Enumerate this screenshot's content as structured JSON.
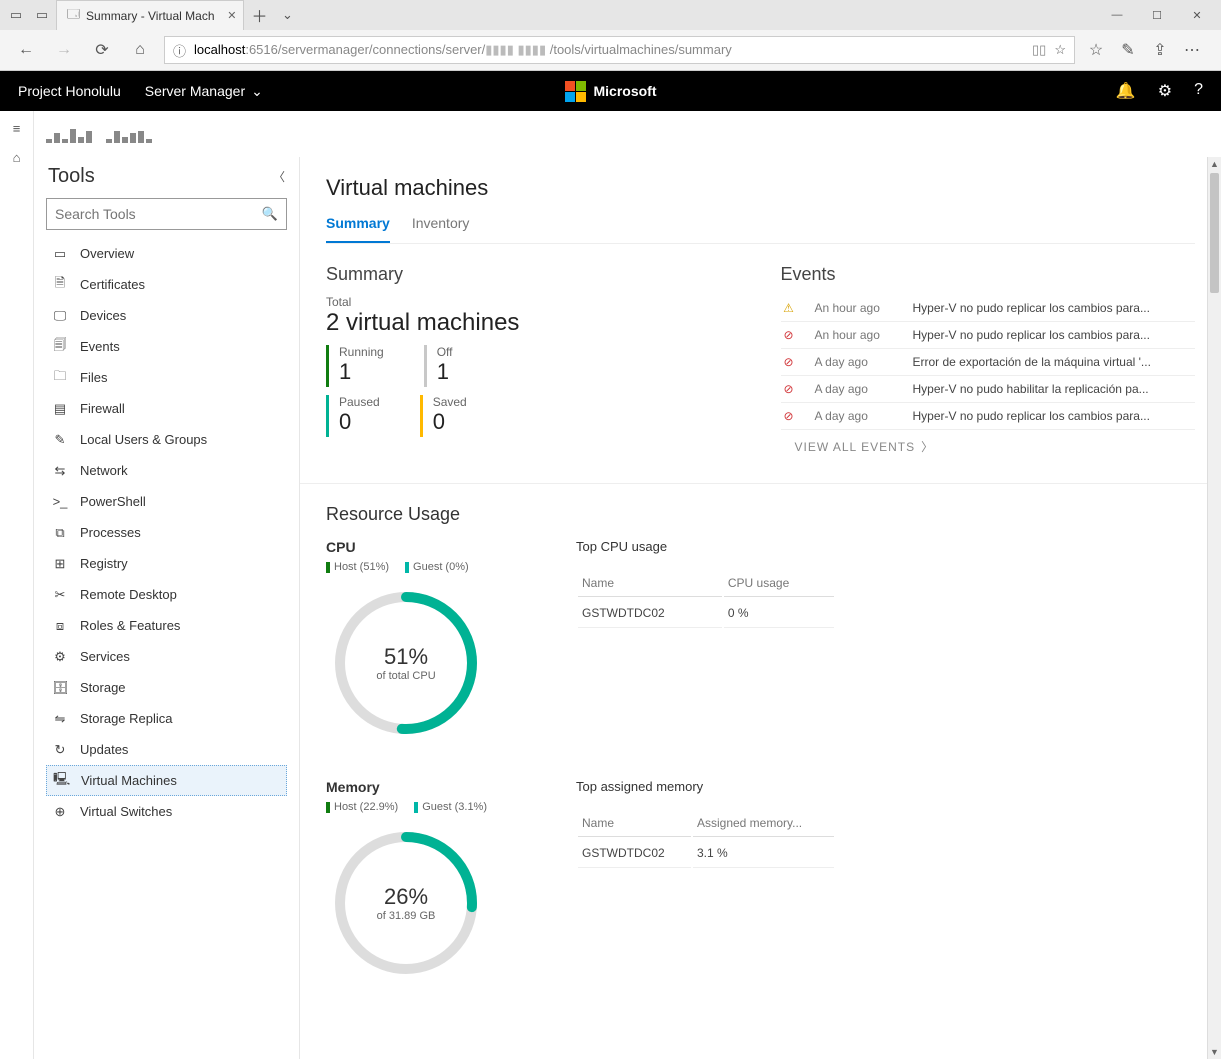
{
  "browser": {
    "tab_title": "Summary - Virtual Mach",
    "addr_host": "localhost",
    "addr_port": ":6516",
    "addr_path_a": "/servermanager/connections/server/",
    "addr_path_b": "/tools/virtualmachines/summary"
  },
  "header": {
    "brand": "Project Honolulu",
    "dropdown": "Server Manager",
    "ms": "Microsoft"
  },
  "tools": {
    "heading": "Tools",
    "search_placeholder": "Search Tools",
    "items": [
      {
        "icon": "▭",
        "label": "Overview"
      },
      {
        "icon": "🗎",
        "label": "Certificates"
      },
      {
        "icon": "🖵",
        "label": "Devices"
      },
      {
        "icon": "🗐",
        "label": "Events"
      },
      {
        "icon": "🗀",
        "label": "Files"
      },
      {
        "icon": "▤",
        "label": "Firewall"
      },
      {
        "icon": "✎",
        "label": "Local Users & Groups"
      },
      {
        "icon": "⇆",
        "label": "Network"
      },
      {
        "icon": ">_",
        "label": "PowerShell"
      },
      {
        "icon": "⧉",
        "label": "Processes"
      },
      {
        "icon": "⊞",
        "label": "Registry"
      },
      {
        "icon": "✂",
        "label": "Remote Desktop"
      },
      {
        "icon": "⧈",
        "label": "Roles & Features"
      },
      {
        "icon": "⚙",
        "label": "Services"
      },
      {
        "icon": "🗄",
        "label": "Storage"
      },
      {
        "icon": "⇋",
        "label": "Storage Replica"
      },
      {
        "icon": "↻",
        "label": "Updates"
      },
      {
        "icon": "🖳",
        "label": "Virtual Machines"
      },
      {
        "icon": "⊕",
        "label": "Virtual Switches"
      }
    ],
    "active_index": 17
  },
  "page": {
    "title": "Virtual machines",
    "tabs": [
      {
        "label": "Summary",
        "active": true
      },
      {
        "label": "Inventory",
        "active": false
      }
    ],
    "summary": {
      "heading": "Summary",
      "total_label": "Total",
      "total_value": "2 virtual machines",
      "stats": [
        {
          "label": "Running",
          "value": "1",
          "color": "green"
        },
        {
          "label": "Off",
          "value": "1",
          "color": "gray"
        },
        {
          "label": "Paused",
          "value": "0",
          "color": "teal"
        },
        {
          "label": "Saved",
          "value": "0",
          "color": "yellow"
        }
      ]
    },
    "events": {
      "heading": "Events",
      "rows": [
        {
          "sev": "warn",
          "time": "An hour ago",
          "msg": "Hyper-V no pudo replicar los cambios para..."
        },
        {
          "sev": "err",
          "time": "An hour ago",
          "msg": "Hyper-V no pudo replicar los cambios para..."
        },
        {
          "sev": "err",
          "time": "A day ago",
          "msg": "Error de exportación de la máquina virtual '..."
        },
        {
          "sev": "err",
          "time": "A day ago",
          "msg": "Hyper-V no pudo habilitar la replicación pa..."
        },
        {
          "sev": "err",
          "time": "A day ago",
          "msg": "Hyper-V no pudo replicar los cambios para..."
        }
      ],
      "view_all": "VIEW ALL EVENTS"
    },
    "resource": {
      "heading": "Resource Usage",
      "cpu": {
        "title": "CPU",
        "legend_host": "Host (51%)",
        "legend_guest": "Guest (0%)",
        "percent": 51,
        "center_big": "51%",
        "center_small": "of total CPU",
        "table_title": "Top CPU usage",
        "col1": "Name",
        "col2": "CPU usage",
        "rows": [
          {
            "name": "GSTWDTDC02",
            "val": "0 %"
          }
        ]
      },
      "memory": {
        "title": "Memory",
        "legend_host": "Host (22.9%)",
        "legend_guest": "Guest (3.1%)",
        "percent": 26,
        "center_big": "26%",
        "center_small": "of 31.89 GB",
        "table_title": "Top assigned memory",
        "col1": "Name",
        "col2": "Assigned memory...",
        "rows": [
          {
            "name": "GSTWDTDC02",
            "val": "3.1 %"
          }
        ]
      }
    }
  }
}
